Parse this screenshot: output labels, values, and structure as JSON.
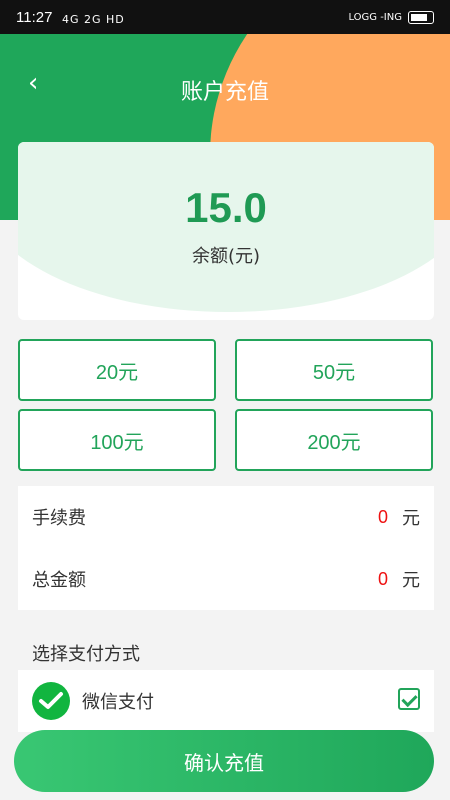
{
  "status": {
    "time": "11:27",
    "signal": "4G 2G HD",
    "network_right": "LOGG -ING"
  },
  "header": {
    "title": "账户充值"
  },
  "balance": {
    "amount": "15.0",
    "label": "余额(元)"
  },
  "options": [
    "20元",
    "50元",
    "100元",
    "200元"
  ],
  "fees": {
    "fee_label": "手续费",
    "fee_value": "0",
    "fee_unit": "元",
    "total_label": "总金额",
    "total_value": "0",
    "total_unit": "元"
  },
  "payment": {
    "title": "选择支付方式",
    "method": "微信支付"
  },
  "actions": {
    "confirm": "确认充值"
  }
}
